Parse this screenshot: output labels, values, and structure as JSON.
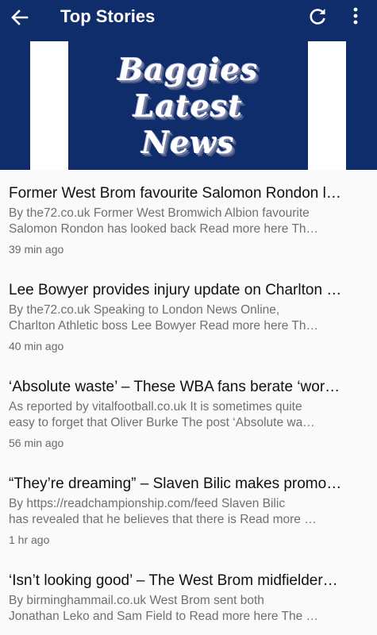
{
  "appbar": {
    "title": "Top Stories",
    "back_icon": "arrow-left-icon",
    "refresh_icon": "refresh-icon",
    "menu_icon": "more-vertical-icon",
    "color": "#0f2d6b"
  },
  "banner": {
    "line1": "Baggies",
    "line2": "Latest",
    "line3": "News"
  },
  "stories": [
    {
      "headline": "Former West Brom favourite Salomon Rondon l…",
      "summary_line1": "By the72.co.uk Former West Bromwich Albion favourite",
      "summary_line2": "Salomon Rondon has looked back Read more here Th…",
      "age": "39 min ago"
    },
    {
      "headline": "Lee Bowyer provides injury update on Charlton …",
      "summary_line1": "By the72.co.uk Speaking to London News Online,",
      "summary_line2": "Charlton Athletic boss Lee Bowyer Read more here Th…",
      "age": "40 min ago"
    },
    {
      "headline": "‘Absolute waste’ – These WBA fans berate ‘wor…",
      "summary_line1": "As reported by vitalfootball.co.uk It is sometimes quite",
      "summary_line2": "easy to forget that Oliver Burke The post ‘Absolute wa…",
      "age": "56 min ago"
    },
    {
      "headline": "“They’re dreaming” – Slaven Bilic makes promo…",
      "summary_line1": "By https://readchampionship.com/feed Slaven Bilic",
      "summary_line2": "has revealed that he believes that there is Read more …",
      "age": "1 hr ago"
    },
    {
      "headline": "‘Isn’t looking good’ – The West Brom midfielder…",
      "summary_line1": "By birminghammail.co.uk West Brom sent both",
      "summary_line2": "Jonathan Leko and Sam Field to Read more here The …",
      "age": ""
    }
  ]
}
